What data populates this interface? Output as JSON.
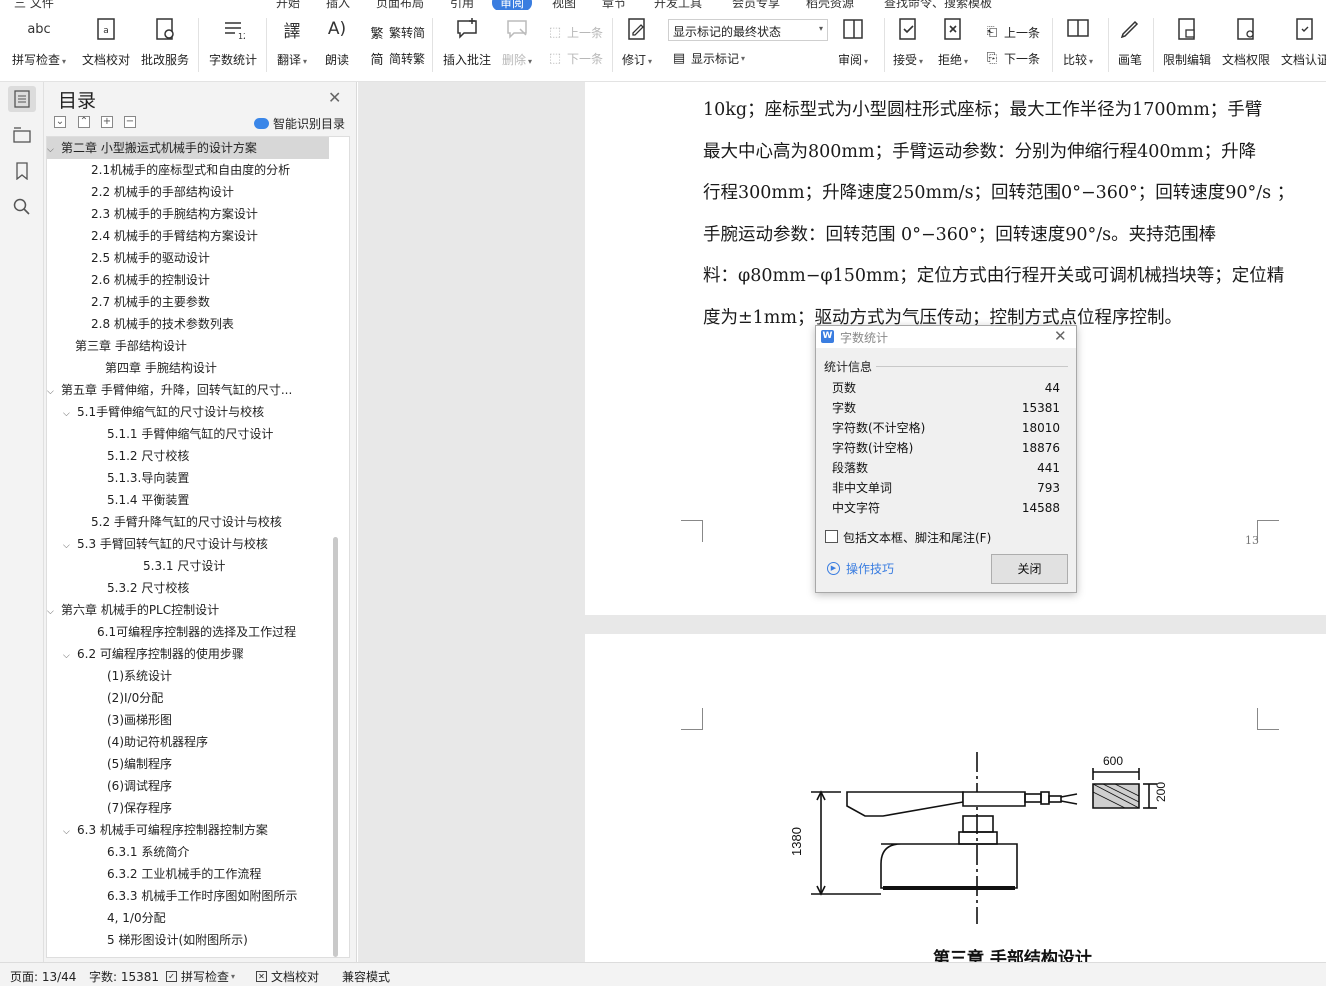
{
  "menu": {
    "items": [
      "三 文件",
      "开始",
      "插入",
      "页面布局",
      "引用",
      "审阅",
      "视图",
      "章节",
      "开发工具",
      "会员专享",
      "稻壳资源",
      "查找命令、搜索模板"
    ],
    "active": "审阅"
  },
  "ribbon": {
    "spell_check": "拼写检查",
    "doc_proofread": "文档校对",
    "approval": "批改服务",
    "word_count": "字数统计",
    "translate": "翻译",
    "read_aloud": "朗读",
    "trad_conv": "繁转简",
    "simp_conv": "简转繁",
    "insert_comment": "插入批注",
    "delete": "删除",
    "prev": "上一条",
    "next": "下一条",
    "revise": "修订",
    "markup_state": "显示标记的最终状态",
    "show_markup": "显示标记",
    "review": "审阅",
    "accept": "接受",
    "reject": "拒绝",
    "prev2": "上一条",
    "next2": "下一条",
    "compare": "比较",
    "pen": "画笔",
    "restrict": "限制编辑",
    "permission": "文档权限",
    "certify": "文档认证"
  },
  "toc": {
    "title": "目录",
    "smart": "智能识别目录",
    "items": [
      {
        "label": "第二章  小型搬运式机械手的设计方案",
        "chev": "⌵",
        "selected": true
      },
      {
        "label": "2.1机械手的座标型式和自由度的分析",
        "chev": ""
      },
      {
        "label": "2.2  机械手的手部结构设计",
        "chev": ""
      },
      {
        "label": "2.3  机械手的手腕结构方案设计",
        "chev": ""
      },
      {
        "label": "2.4  机械手的手臂结构方案设计",
        "chev": ""
      },
      {
        "label": "2.5  机械手的驱动设计",
        "chev": ""
      },
      {
        "label": "2.6  机械手的控制设计",
        "chev": ""
      },
      {
        "label": "2.7  机械手的主要参数",
        "chev": ""
      },
      {
        "label": "2.8  机械手的技术参数列表",
        "chev": ""
      },
      {
        "label": "第三章    手部结构设计",
        "chev": ""
      },
      {
        "label": "第四章    手腕结构设计",
        "chev": ""
      },
      {
        "label": "第五章    手臂伸缩，升降，回转气缸的尺寸...",
        "chev": "⌵"
      },
      {
        "label": "5.1手臂伸缩气缸的尺寸设计与校核",
        "chev": "⌵"
      },
      {
        "label": "5.1.1  手臂伸缩气缸的尺寸设计",
        "chev": ""
      },
      {
        "label": "5.1.2  尺寸校核",
        "chev": ""
      },
      {
        "label": "5.1.3.导向装置",
        "chev": ""
      },
      {
        "label": "5.1.4  平衡装置",
        "chev": ""
      },
      {
        "label": "5.2  手臂升降气缸的尺寸设计与校核",
        "chev": ""
      },
      {
        "label": "5.3  手臂回转气缸的尺寸设计与校核",
        "chev": "⌵"
      },
      {
        "label": "5.3.1  尺寸设计",
        "chev": ""
      },
      {
        "label": "5.3.2  尺寸校核",
        "chev": ""
      },
      {
        "label": "第六章    机械手的PLC控制设计",
        "chev": "⌵"
      },
      {
        "label": "6.1可编程序控制器的选择及工作过程",
        "chev": ""
      },
      {
        "label": "6.2  可编程序控制器的使用步骤",
        "chev": "⌵"
      },
      {
        "label": "(1)系统设计",
        "chev": ""
      },
      {
        "label": "(2)I/0分配",
        "chev": ""
      },
      {
        "label": "(3)画梯形图",
        "chev": ""
      },
      {
        "label": "(4)助记符机器程序",
        "chev": ""
      },
      {
        "label": "(5)编制程序",
        "chev": ""
      },
      {
        "label": "(6)调试程序",
        "chev": ""
      },
      {
        "label": "(7)保存程序",
        "chev": ""
      },
      {
        "label": "6.3  机械手可编程序控制器控制方案",
        "chev": "⌵"
      },
      {
        "label": "6.3.1  系统简介",
        "chev": ""
      },
      {
        "label": "6.3.2  工业机械手的工作流程",
        "chev": ""
      },
      {
        "label": "6.3.3  机械手工作时序图如附图所示",
        "chev": ""
      },
      {
        "label": "4, 1/0分配",
        "chev": ""
      },
      {
        "label": "5   梯形图设计(如附图所示)",
        "chev": ""
      }
    ]
  },
  "doc": {
    "lines": [
      "10kg；座标型式为小型圆柱形式座标；最大工作半径为1700mm；手臂",
      "最大中心高为800mm；手臂运动参数：分别为伸缩行程400mm；升降",
      "行程300mm；升降速度250mm/s；回转范围0°−360°；回转速度90°/s  ；",
      "手腕运动参数：回转范围  0°−360°；回转速度90°/s。夹持范围棒",
      "料：φ80mm−φ150mm；定位方式由行程开关或可调机械挡块等；定位精",
      "度为±1mm；驱动方式为气压传动；控制方式点位程序控制。"
    ],
    "page_number": "13",
    "figure_labels": {
      "width": "600",
      "height": "200",
      "center_height": "1380"
    },
    "caption": "第三章    手部结构设计"
  },
  "dialog": {
    "title": "字数统计",
    "section": "统计信息",
    "stats": [
      {
        "label": "页数",
        "value": "44"
      },
      {
        "label": "字数",
        "value": "15381"
      },
      {
        "label": "字符数(不计空格)",
        "value": "18010"
      },
      {
        "label": "字符数(计空格)",
        "value": "18876"
      },
      {
        "label": "段落数",
        "value": "441"
      },
      {
        "label": "非中文单词",
        "value": "793"
      },
      {
        "label": "中文字符",
        "value": "14588"
      }
    ],
    "include_label": "包括文本框、脚注和尾注(F)",
    "tips": "操作技巧",
    "close": "关闭"
  },
  "status": {
    "page": "页面: 13/44",
    "words": "字数: 15381",
    "spell": "拼写检查",
    "proof": "文档校对",
    "compat": "兼容模式"
  },
  "colors": {
    "accent": "#3a7de0",
    "selected_row": "#d7d7d7",
    "canvas": "#e8e8e8"
  }
}
